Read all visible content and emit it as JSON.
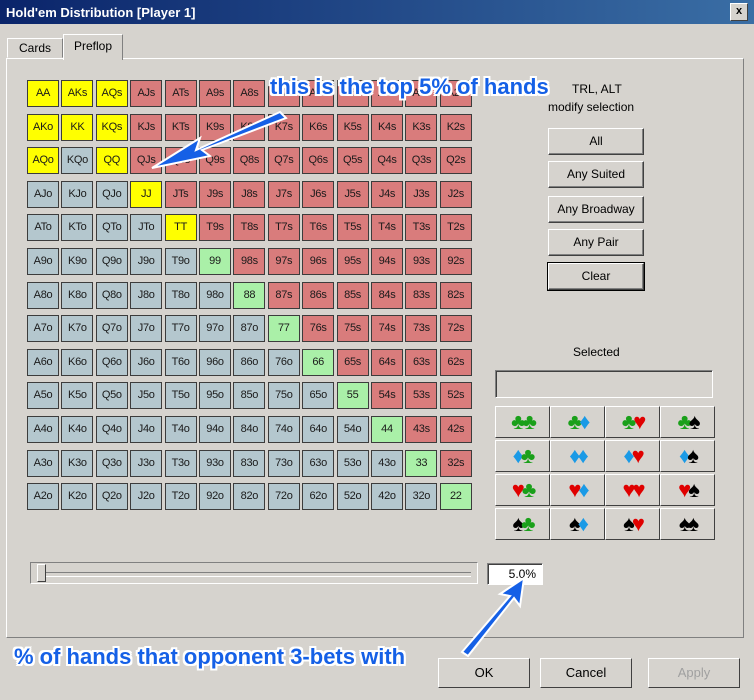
{
  "window": {
    "title": "Hold'em Distribution [Player 1]",
    "close": "x"
  },
  "tabs": [
    {
      "label": "Cards"
    },
    {
      "label": "Preflop"
    }
  ],
  "grid_rows": [
    [
      "AA",
      "AKs",
      "AQs",
      "AJs",
      "ATs",
      "A9s",
      "A8s",
      "A7s",
      "A6s",
      "A5s",
      "A4s",
      "A3s",
      "A2s"
    ],
    [
      "AKo",
      "KK",
      "KQs",
      "KJs",
      "KTs",
      "K9s",
      "K8s",
      "K7s",
      "K6s",
      "K5s",
      "K4s",
      "K3s",
      "K2s"
    ],
    [
      "AQo",
      "KQo",
      "QQ",
      "QJs",
      "QTs",
      "Q9s",
      "Q8s",
      "Q7s",
      "Q6s",
      "Q5s",
      "Q4s",
      "Q3s",
      "Q2s"
    ],
    [
      "AJo",
      "KJo",
      "QJo",
      "JJ",
      "JTs",
      "J9s",
      "J8s",
      "J7s",
      "J6s",
      "J5s",
      "J4s",
      "J3s",
      "J2s"
    ],
    [
      "ATo",
      "KTo",
      "QTo",
      "JTo",
      "TT",
      "T9s",
      "T8s",
      "T7s",
      "T6s",
      "T5s",
      "T4s",
      "T3s",
      "T2s"
    ],
    [
      "A9o",
      "K9o",
      "Q9o",
      "J9o",
      "T9o",
      "99",
      "98s",
      "97s",
      "96s",
      "95s",
      "94s",
      "93s",
      "92s"
    ],
    [
      "A8o",
      "K8o",
      "Q8o",
      "J8o",
      "T8o",
      "98o",
      "88",
      "87s",
      "86s",
      "85s",
      "84s",
      "83s",
      "82s"
    ],
    [
      "A7o",
      "K7o",
      "Q7o",
      "J7o",
      "T7o",
      "97o",
      "87o",
      "77",
      "76s",
      "75s",
      "74s",
      "73s",
      "72s"
    ],
    [
      "A6o",
      "K6o",
      "Q6o",
      "J6o",
      "T6o",
      "96o",
      "86o",
      "76o",
      "66",
      "65s",
      "64s",
      "63s",
      "62s"
    ],
    [
      "A5o",
      "K5o",
      "Q5o",
      "J5o",
      "T5o",
      "95o",
      "85o",
      "75o",
      "65o",
      "55",
      "54s",
      "53s",
      "52s"
    ],
    [
      "A4o",
      "K4o",
      "Q4o",
      "J4o",
      "T4o",
      "94o",
      "84o",
      "74o",
      "64o",
      "54o",
      "44",
      "43s",
      "42s"
    ],
    [
      "A3o",
      "K3o",
      "Q3o",
      "J3o",
      "T3o",
      "93o",
      "83o",
      "73o",
      "63o",
      "53o",
      "43o",
      "33",
      "32s"
    ],
    [
      "A2o",
      "K2o",
      "Q2o",
      "J2o",
      "T2o",
      "92o",
      "82o",
      "72o",
      "62o",
      "52o",
      "42o",
      "32o",
      "22"
    ]
  ],
  "selected_hands": [
    "AA",
    "AKs",
    "AQs",
    "AKo",
    "KK",
    "KQs",
    "AQo",
    "QQ",
    "JJ",
    "TT"
  ],
  "colors": {
    "selected": "#ffff00",
    "pair": "#aaf0a8",
    "suited": "#d97c7c",
    "offsuit": "#b4c7ce"
  },
  "side": {
    "hint_line1": "TRL, ALT",
    "hint_line2": "modify selection",
    "buttons": [
      "All",
      "Any Suited",
      "Any Broadway",
      "Any Pair",
      "Clear"
    ],
    "selected_label": "Selected",
    "suit_combos": [
      [
        [
          "club",
          "club"
        ],
        [
          "club",
          "diamond"
        ],
        [
          "club",
          "heart"
        ],
        [
          "club",
          "spade"
        ]
      ],
      [
        [
          "diamond",
          "club"
        ],
        [
          "diamond",
          "diamond"
        ],
        [
          "diamond",
          "heart"
        ],
        [
          "diamond",
          "spade"
        ]
      ],
      [
        [
          "heart",
          "club"
        ],
        [
          "heart",
          "diamond"
        ],
        [
          "heart",
          "heart"
        ],
        [
          "heart",
          "spade"
        ]
      ],
      [
        [
          "spade",
          "club"
        ],
        [
          "spade",
          "diamond"
        ],
        [
          "spade",
          "heart"
        ],
        [
          "spade",
          "spade"
        ]
      ]
    ]
  },
  "slider": {
    "percent_text": "5.0%",
    "level_fraction": 0.0
  },
  "footer": {
    "ok": "OK",
    "cancel": "Cancel",
    "apply": "Apply"
  },
  "annotations": {
    "top": "this is the top 5% of hands",
    "bottom": "% of hands that opponent 3-bets with"
  }
}
